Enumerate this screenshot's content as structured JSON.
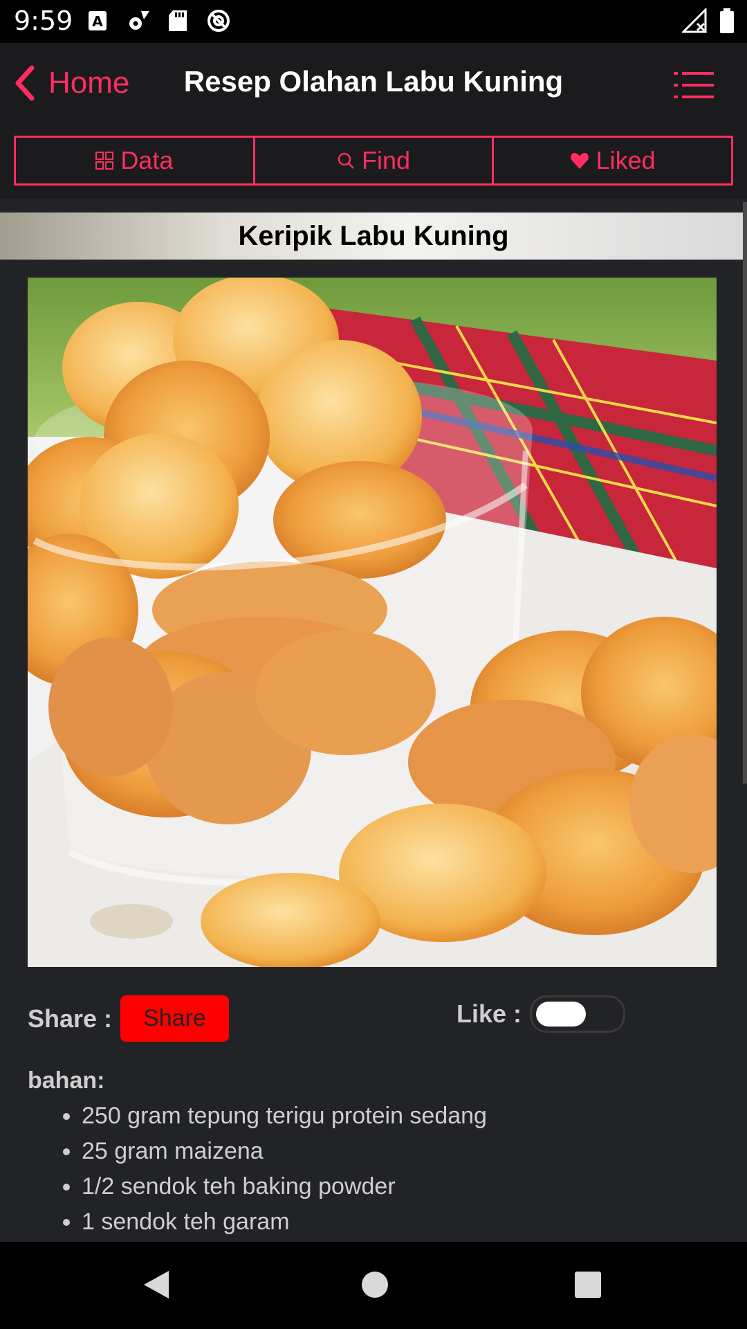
{
  "status_bar": {
    "time": "9:59",
    "icons": [
      "a-icon",
      "settings-icon",
      "sd-card-icon",
      "at-icon"
    ],
    "right_icons": [
      "signal-icon",
      "battery-icon"
    ]
  },
  "header": {
    "back_label": "Home",
    "title": "Resep Olahan Labu Kuning",
    "accent": "#ff2d60"
  },
  "tabs": [
    {
      "label": "Data",
      "icon": "grid-icon"
    },
    {
      "label": "Find",
      "icon": "search-icon"
    },
    {
      "label": "Liked",
      "icon": "heart-icon"
    }
  ],
  "recipe": {
    "title": "Keripik Labu Kuning",
    "share_label": "Share :",
    "share_button": "Share",
    "like_label": "Like :",
    "liked": false,
    "ingredients_heading": "bahan:",
    "ingredients": [
      "250 gram tepung terigu protein sedang",
      "25 gram maizena",
      "1/2 sendok teh baking powder",
      "1 sendok teh garam"
    ]
  },
  "nav": [
    "back-icon",
    "home-icon",
    "recents-icon"
  ]
}
